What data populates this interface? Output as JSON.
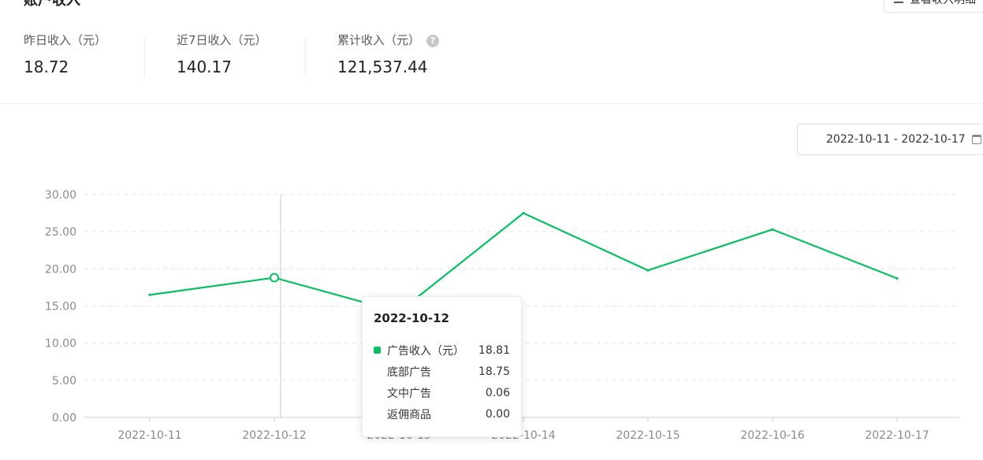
{
  "header": {
    "title": "账户收入",
    "view_button_label": "查看收入明细"
  },
  "stats": [
    {
      "label": "昨日收入（元）",
      "value": "18.72"
    },
    {
      "label": "近7日收入（元）",
      "value": "140.17"
    },
    {
      "label": "累计收入（元）",
      "value": "121,537.44"
    }
  ],
  "date_range": "2022-10-11 - 2022-10-17",
  "icons": {
    "help": "help-icon",
    "calendar": "calendar-icon",
    "list": "list-icon"
  },
  "colors": {
    "series": "#07c160",
    "grid": "#e3e3e3",
    "axis_text": "#8a8a8a"
  },
  "tooltip": {
    "date": "2022-10-12",
    "rows": [
      {
        "label": "广告收入（元）",
        "value": "18.81"
      },
      {
        "label": "底部广告",
        "value": "18.75"
      },
      {
        "label": "文中广告",
        "value": "0.06"
      },
      {
        "label": "返佣商品",
        "value": "0.00"
      }
    ]
  },
  "chart_data": {
    "type": "line",
    "x": [
      "2022-10-11",
      "2022-10-12",
      "2022-10-13",
      "2022-10-14",
      "2022-10-15",
      "2022-10-16",
      "2022-10-17"
    ],
    "series": [
      {
        "values": [
          16.5,
          18.81,
          14.2,
          27.5,
          19.8,
          25.3,
          18.72
        ]
      }
    ],
    "yticks": [
      "0.00",
      "5.00",
      "10.00",
      "15.00",
      "20.00",
      "25.00",
      "30.00"
    ],
    "ylim": [
      0,
      30
    ],
    "grid": true,
    "highlight_index": 1
  }
}
